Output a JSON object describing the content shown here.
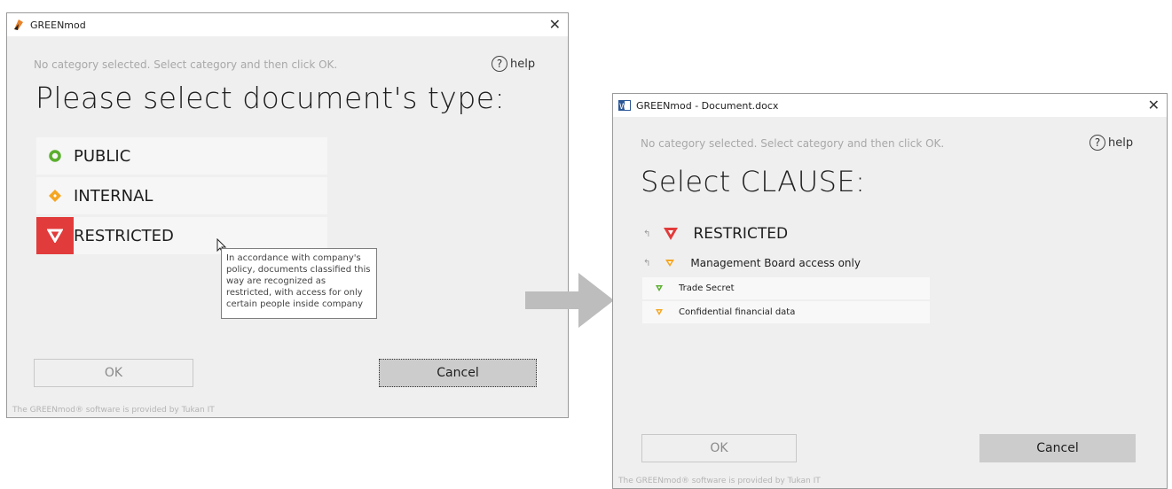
{
  "left_window": {
    "title": "GREENmod",
    "close_glyph": "✕",
    "hint": "No category selected. Select category and then click OK.",
    "help_glyph": "?",
    "help_label": "help",
    "heading": "Please select document's type:",
    "categories": [
      {
        "label": "PUBLIC",
        "icon": "green-circle-icon",
        "color": "#5aae2e"
      },
      {
        "label": "INTERNAL",
        "icon": "orange-diamond-icon",
        "color": "#f5a623"
      },
      {
        "label": "RESTRICTED",
        "icon": "red-down-triangle-icon",
        "color": "#e23b3b",
        "selected": true
      }
    ],
    "tooltip": "In accordance with company's policy, documents classified this way are recognized as restricted, with access for only certain people inside company",
    "ok_label": "OK",
    "cancel_label": "Cancel",
    "footer": "The GREENmod® software is provided by Tukan IT"
  },
  "right_window": {
    "title": "GREENmod - Document.docx",
    "close_glyph": "✕",
    "hint": "No category selected. Select category and then click OK.",
    "help_glyph": "?",
    "help_label": "help",
    "heading": "Select CLAUSE:",
    "parent": {
      "label": "RESTRICTED",
      "color": "#e23b3b"
    },
    "subparent": {
      "label": "Management Board access only",
      "color": "#f5a623"
    },
    "clauses": [
      {
        "label": "Trade Secret",
        "color": "#5aae2e"
      },
      {
        "label": "Confidential financial data",
        "color": "#f5a623"
      }
    ],
    "ok_label": "OK",
    "cancel_label": "Cancel",
    "footer": "The GREENmod® software is provided by Tukan IT"
  },
  "colors": {
    "window_bg": "#efefef",
    "arrow": "#bdbdbd",
    "cancel_bg": "#c9c9c9",
    "restricted_red": "#e23b3b"
  }
}
